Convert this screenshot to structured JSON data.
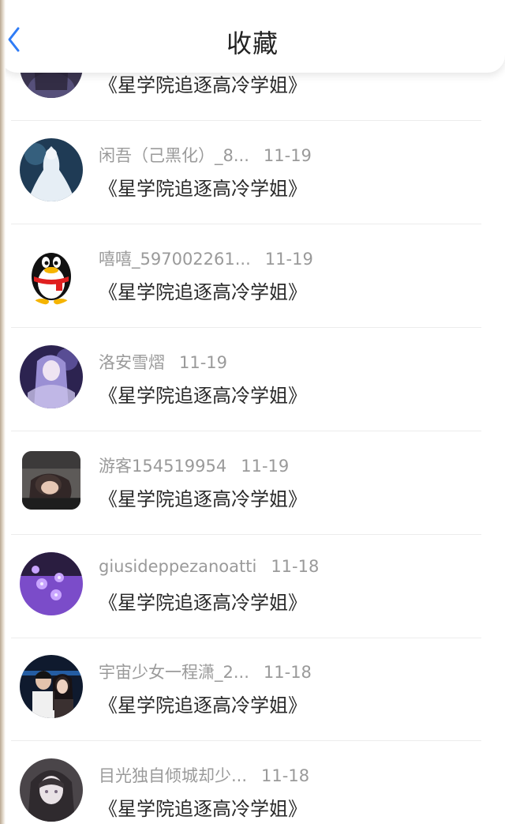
{
  "header": {
    "title": "收藏",
    "back_icon": "back-chevron-icon",
    "accent": "#2f7cf6"
  },
  "items": [
    {
      "name": "",
      "date": "",
      "book": "《星学院追逐高冷学姐》",
      "avatar": "anime-girl-dark-avatar"
    },
    {
      "name": "闲吾（己黑化）_8...",
      "date": "11-19",
      "book": "《星学院追逐高冷学姐》",
      "avatar": "white-dress-girl-avatar"
    },
    {
      "name": "嘻嘻_597002261...",
      "date": "11-19",
      "book": "《星学院追逐高冷学姐》",
      "avatar": "qq-penguin-avatar"
    },
    {
      "name": "洛安雪熠",
      "date": "11-19",
      "book": "《星学院追逐高冷学姐》",
      "avatar": "purple-anime-girl-avatar"
    },
    {
      "name": "游客154519954",
      "date": "11-19",
      "book": "《星学院追逐高冷学姐》",
      "avatar": "sleeping-girl-photo-avatar"
    },
    {
      "name": "giusideppezanoatti",
      "date": "11-18",
      "book": "《星学院追逐高冷学姐》",
      "avatar": "purple-flowers-avatar"
    },
    {
      "name": "宇宙少女一程潇_2...",
      "date": "11-18",
      "book": "《星学院追逐高冷学姐》",
      "avatar": "couple-photo-avatar"
    },
    {
      "name": "目光独自倾城却少...",
      "date": "11-18",
      "book": "《星学院追逐高冷学姐》",
      "avatar": "gray-anime-girl-avatar"
    }
  ]
}
